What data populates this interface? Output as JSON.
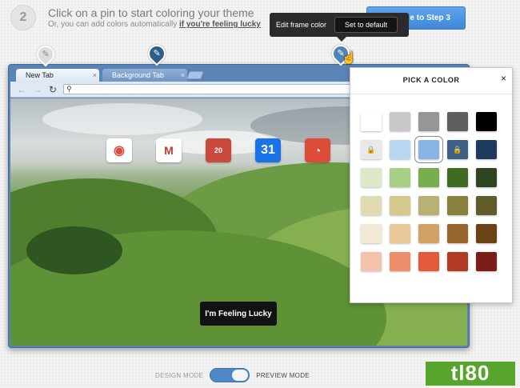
{
  "header": {
    "step_number": "2",
    "title": "Click on a pin to start coloring your theme",
    "subtitle_prefix": "Or, you can add colors automatically",
    "subtitle_link": "if you're feeling lucky",
    "continue_label": "e to Step 3"
  },
  "tooltip": {
    "label": "Edit frame color",
    "button": "Set to default"
  },
  "pins": [
    {
      "name": "pin-1",
      "icon": "brush-icon"
    },
    {
      "name": "pin-2",
      "icon": "brush-icon"
    },
    {
      "name": "pin-3",
      "icon": "brush-icon"
    }
  ],
  "browser": {
    "tabs": [
      {
        "label": "New Tab",
        "close": "×",
        "active": true
      },
      {
        "label": "Background Tab",
        "close": "×",
        "active": false
      }
    ],
    "apps": [
      "chrome-icon",
      "gmail-icon",
      "books-icon",
      "calendar-icon",
      "reader-icon"
    ],
    "calendar_day": "31",
    "books_text": "20",
    "lucky_button": "I'm Feeling Lucky"
  },
  "picker": {
    "title": "PICK A COLOR",
    "close": "×",
    "swatches": [
      [
        "#ffffff",
        "#c8c8c8",
        "#969696",
        "#5e5e5e",
        "#000000"
      ],
      [
        "#e8e8e8",
        "#b9d6f2",
        "#88b5e6",
        "#3e5f86",
        "#1f3a5f"
      ],
      [
        "#dde8c9",
        "#a8cf86",
        "#76ad51",
        "#3f6b22",
        "#2f4420"
      ],
      [
        "#e0dbb0",
        "#d3c98c",
        "#b7b175",
        "#88803f",
        "#5f5b2d"
      ],
      [
        "#f1ead7",
        "#e9c99a",
        "#d1a266",
        "#97652c",
        "#6a4216"
      ],
      [
        "#f4c1ad",
        "#ee8d6c",
        "#e55a3b",
        "#b13a25",
        "#7b1e1a"
      ]
    ],
    "locked": [
      "1-0",
      "1-3"
    ],
    "selected": "1-2"
  },
  "mode": {
    "design": "DESIGN MODE",
    "preview": "PREVIEW MODE",
    "preview_on": true
  },
  "watermark": "tl80"
}
